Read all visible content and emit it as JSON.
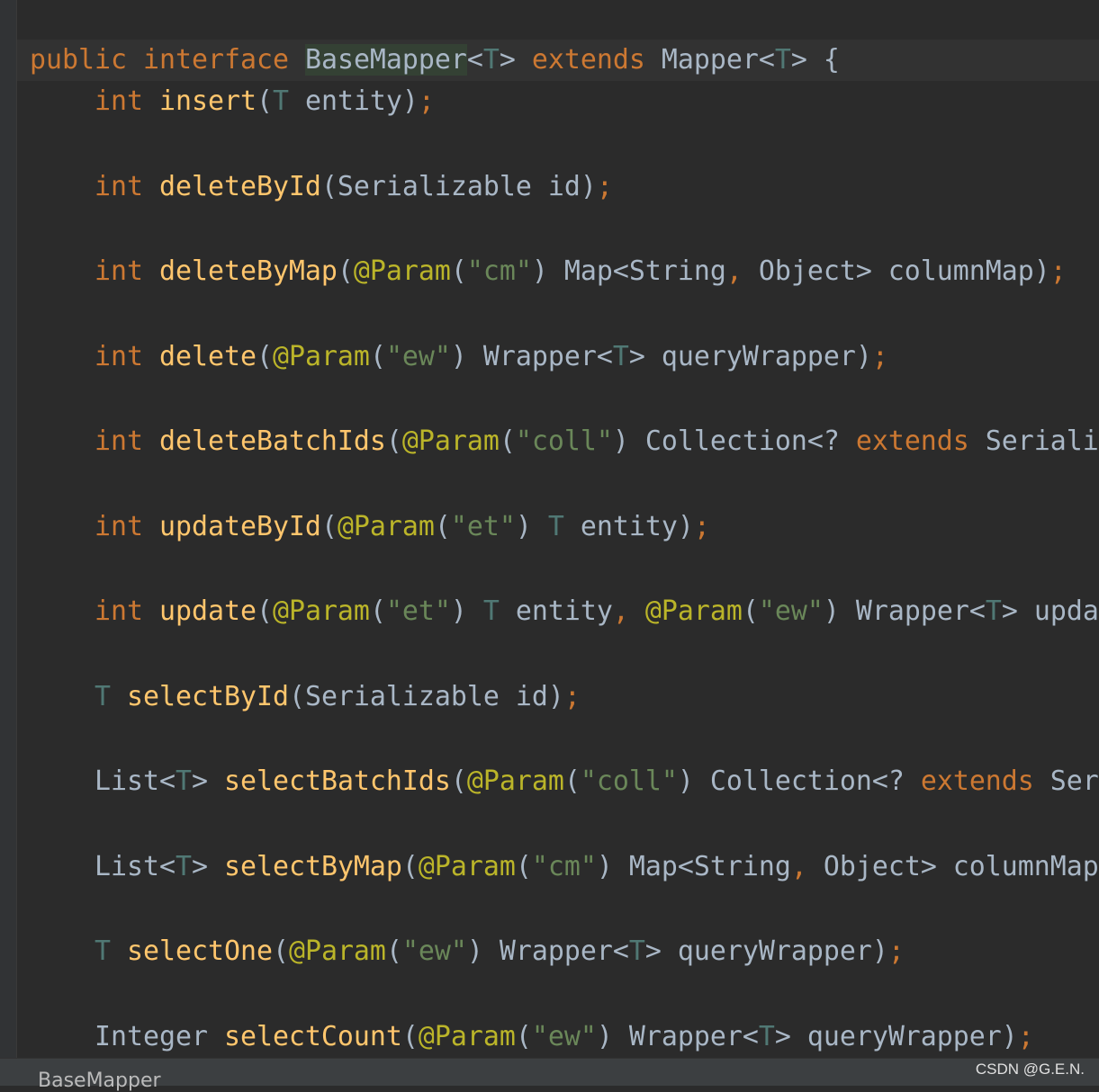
{
  "colors": {
    "background": "#2b2b2b",
    "keyword": "#cc7832",
    "method": "#ffc66d",
    "text": "#a9b7c6",
    "type_param": "#507874",
    "annotation": "#bbb529",
    "string": "#6a8759"
  },
  "code": [
    [
      [
        "kw",
        "public "
      ],
      [
        "kw",
        "interface "
      ],
      [
        "hl",
        "BaseMapper"
      ],
      [
        "pl",
        "<"
      ],
      [
        "tp",
        "T"
      ],
      [
        "pl",
        "> "
      ],
      [
        "kw",
        "extends "
      ],
      [
        "pl",
        "Mapper<"
      ],
      [
        "tp",
        "T"
      ],
      [
        "pl",
        "> {"
      ]
    ],
    [
      [
        "pl",
        "    "
      ],
      [
        "kw",
        "int "
      ],
      [
        "fn",
        "insert"
      ],
      [
        "pl",
        "("
      ],
      [
        "tp",
        "T"
      ],
      [
        "pl",
        " entity)"
      ],
      [
        "pn",
        ";"
      ]
    ],
    [
      [
        "pl",
        "    "
      ],
      [
        "kw",
        "int "
      ],
      [
        "fn",
        "deleteById"
      ],
      [
        "pl",
        "(Serializable id)"
      ],
      [
        "pn",
        ";"
      ]
    ],
    [
      [
        "pl",
        "    "
      ],
      [
        "kw",
        "int "
      ],
      [
        "fn",
        "deleteByMap"
      ],
      [
        "pl",
        "("
      ],
      [
        "ann",
        "@Param"
      ],
      [
        "pl",
        "("
      ],
      [
        "str",
        "\"cm\""
      ],
      [
        "pl",
        ") Map<String"
      ],
      [
        "pn",
        ", "
      ],
      [
        "pl",
        "Object> columnMap)"
      ],
      [
        "pn",
        ";"
      ]
    ],
    [
      [
        "pl",
        "    "
      ],
      [
        "kw",
        "int "
      ],
      [
        "fn",
        "delete"
      ],
      [
        "pl",
        "("
      ],
      [
        "ann",
        "@Param"
      ],
      [
        "pl",
        "("
      ],
      [
        "str",
        "\"ew\""
      ],
      [
        "pl",
        ") Wrapper<"
      ],
      [
        "tp",
        "T"
      ],
      [
        "pl",
        "> queryWrapper)"
      ],
      [
        "pn",
        ";"
      ]
    ],
    [
      [
        "pl",
        "    "
      ],
      [
        "kw",
        "int "
      ],
      [
        "fn",
        "deleteBatchIds"
      ],
      [
        "pl",
        "("
      ],
      [
        "ann",
        "@Param"
      ],
      [
        "pl",
        "("
      ],
      [
        "str",
        "\"coll\""
      ],
      [
        "pl",
        ") Collection<? "
      ],
      [
        "kw",
        "extends "
      ],
      [
        "pl",
        "Seriali"
      ]
    ],
    [
      [
        "pl",
        "    "
      ],
      [
        "kw",
        "int "
      ],
      [
        "fn",
        "updateById"
      ],
      [
        "pl",
        "("
      ],
      [
        "ann",
        "@Param"
      ],
      [
        "pl",
        "("
      ],
      [
        "str",
        "\"et\""
      ],
      [
        "pl",
        ") "
      ],
      [
        "tp",
        "T"
      ],
      [
        "pl",
        " entity)"
      ],
      [
        "pn",
        ";"
      ]
    ],
    [
      [
        "pl",
        "    "
      ],
      [
        "kw",
        "int "
      ],
      [
        "fn",
        "update"
      ],
      [
        "pl",
        "("
      ],
      [
        "ann",
        "@Param"
      ],
      [
        "pl",
        "("
      ],
      [
        "str",
        "\"et\""
      ],
      [
        "pl",
        ") "
      ],
      [
        "tp",
        "T"
      ],
      [
        "pl",
        " entity"
      ],
      [
        "pn",
        ", "
      ],
      [
        "ann",
        "@Param"
      ],
      [
        "pl",
        "("
      ],
      [
        "str",
        "\"ew\""
      ],
      [
        "pl",
        ") Wrapper<"
      ],
      [
        "tp",
        "T"
      ],
      [
        "pl",
        "> upda"
      ]
    ],
    [
      [
        "pl",
        "    "
      ],
      [
        "tp",
        "T "
      ],
      [
        "fn",
        "selectById"
      ],
      [
        "pl",
        "(Serializable id)"
      ],
      [
        "pn",
        ";"
      ]
    ],
    [
      [
        "pl",
        "    List<"
      ],
      [
        "tp",
        "T"
      ],
      [
        "pl",
        "> "
      ],
      [
        "fn",
        "selectBatchIds"
      ],
      [
        "pl",
        "("
      ],
      [
        "ann",
        "@Param"
      ],
      [
        "pl",
        "("
      ],
      [
        "str",
        "\"coll\""
      ],
      [
        "pl",
        ") Collection<? "
      ],
      [
        "kw",
        "extends "
      ],
      [
        "pl",
        "Ser"
      ]
    ],
    [
      [
        "pl",
        "    List<"
      ],
      [
        "tp",
        "T"
      ],
      [
        "pl",
        "> "
      ],
      [
        "fn",
        "selectByMap"
      ],
      [
        "pl",
        "("
      ],
      [
        "ann",
        "@Param"
      ],
      [
        "pl",
        "("
      ],
      [
        "str",
        "\"cm\""
      ],
      [
        "pl",
        ") Map<String"
      ],
      [
        "pn",
        ", "
      ],
      [
        "pl",
        "Object> columnMap"
      ]
    ],
    [
      [
        "pl",
        "    "
      ],
      [
        "tp",
        "T "
      ],
      [
        "fn",
        "selectOne"
      ],
      [
        "pl",
        "("
      ],
      [
        "ann",
        "@Param"
      ],
      [
        "pl",
        "("
      ],
      [
        "str",
        "\"ew\""
      ],
      [
        "pl",
        ") Wrapper<"
      ],
      [
        "tp",
        "T"
      ],
      [
        "pl",
        "> queryWrapper)"
      ],
      [
        "pn",
        ";"
      ]
    ],
    [
      [
        "pl",
        "    Integer "
      ],
      [
        "fn",
        "selectCount"
      ],
      [
        "pl",
        "("
      ],
      [
        "ann",
        "@Param"
      ],
      [
        "pl",
        "("
      ],
      [
        "str",
        "\"ew\""
      ],
      [
        "pl",
        ") Wrapper<"
      ],
      [
        "tp",
        "T"
      ],
      [
        "pl",
        "> queryWrapper)"
      ],
      [
        "pn",
        ";"
      ]
    ]
  ],
  "status": {
    "breadcrumb": "BaseMapper"
  },
  "watermark": "CSDN @G.E.N."
}
